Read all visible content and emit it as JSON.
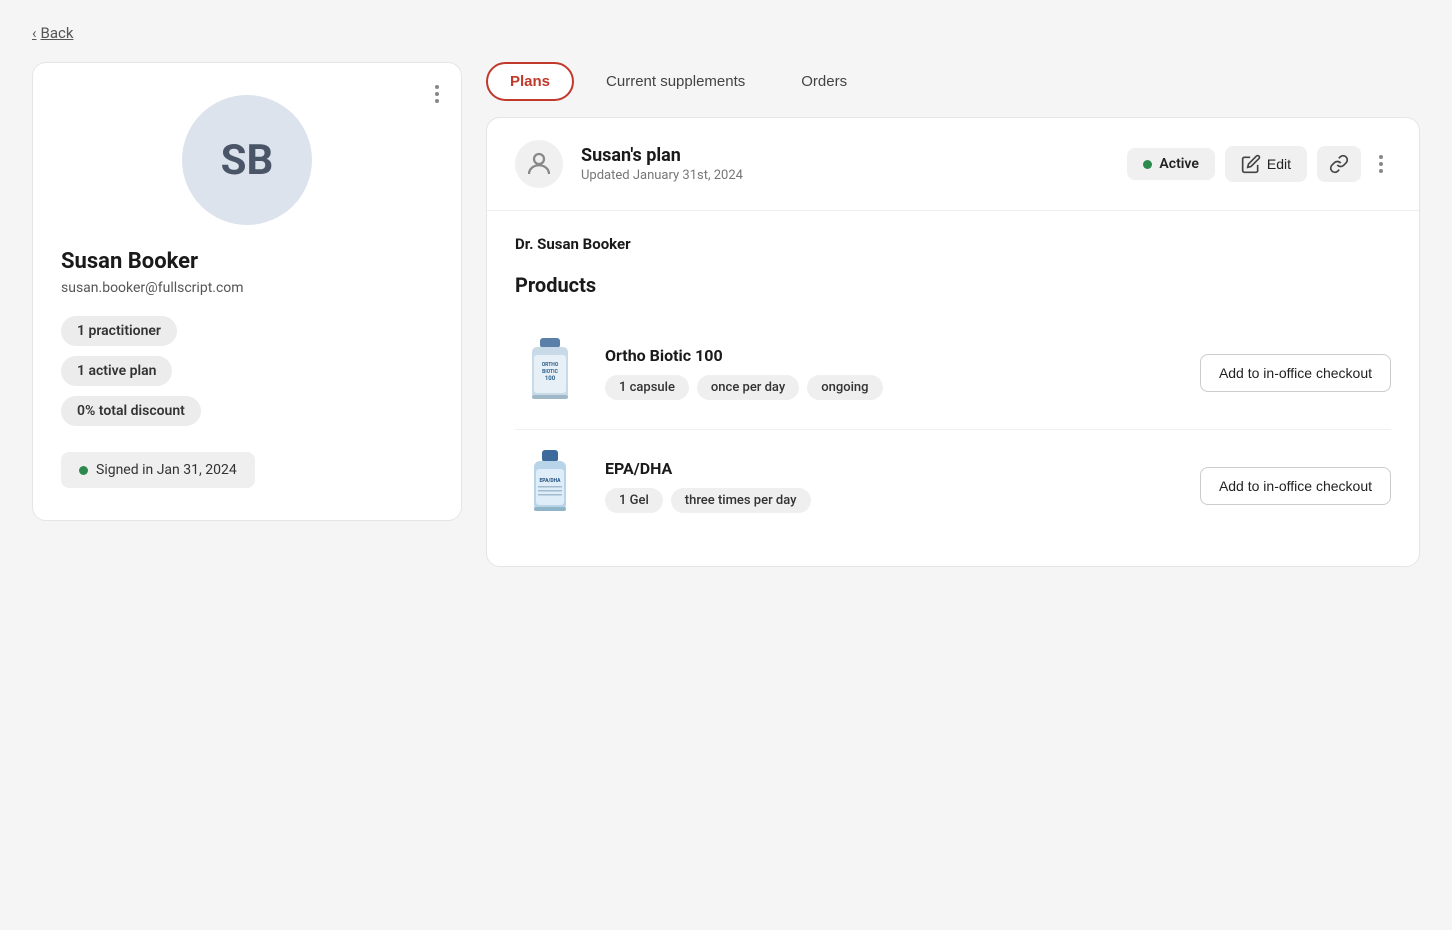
{
  "back_label": "Back",
  "left_panel": {
    "avatar_initials": "SB",
    "patient_name": "Susan Booker",
    "patient_email": "susan.booker@fullscript.com",
    "badges": [
      {
        "label": "1 practitioner"
      },
      {
        "label": "1 active plan"
      },
      {
        "label": "0% total discount"
      }
    ],
    "signed_in_label": "Signed in Jan 31, 2024"
  },
  "tabs": [
    {
      "label": "Plans",
      "active": true
    },
    {
      "label": "Current supplements",
      "active": false
    },
    {
      "label": "Orders",
      "active": false
    }
  ],
  "plan_card": {
    "plan_name": "Susan's plan",
    "plan_updated": "Updated January 31st, 2024",
    "status_label": "Active",
    "edit_label": "Edit",
    "doctor_name": "Dr. Susan Booker",
    "products_heading": "Products",
    "products": [
      {
        "name": "Ortho Biotic 100",
        "tags": [
          "1 capsule",
          "once per day",
          "ongoing"
        ],
        "add_label": "Add to in-office checkout",
        "img_color": "#b8cce4",
        "img_text": "Ortho\nBiotic\n100"
      },
      {
        "name": "EPA/DHA",
        "tags": [
          "1 Gel",
          "three times per day"
        ],
        "add_label": "Add to in-office checkout",
        "img_color": "#9dc3e6",
        "img_text": "EPA/DHA"
      }
    ]
  }
}
